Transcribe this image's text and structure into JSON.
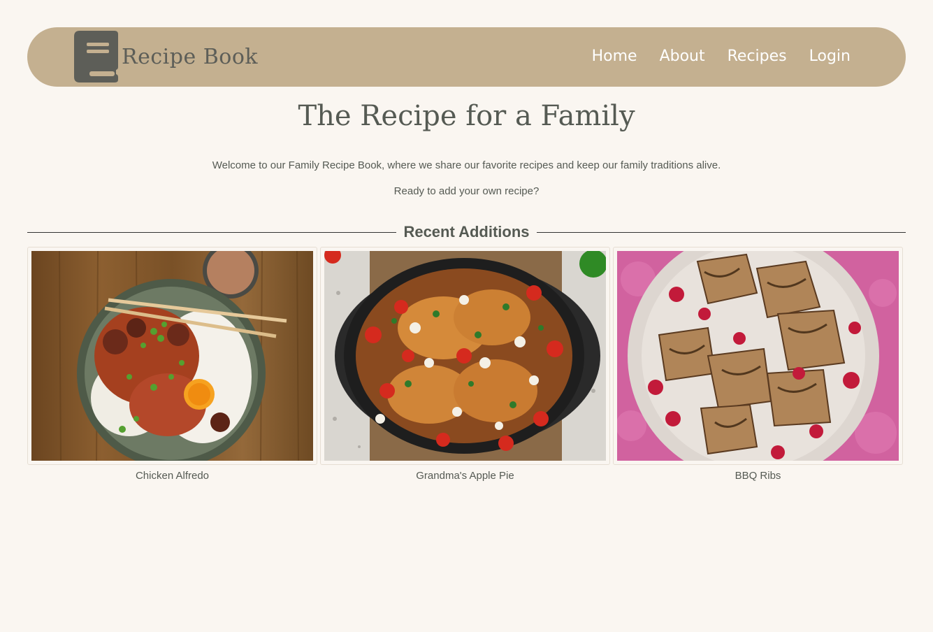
{
  "header": {
    "logo_icon": "book-icon",
    "brand": "Recipe Book",
    "nav": [
      "Home",
      "About",
      "Recipes",
      "Login"
    ]
  },
  "hero": {
    "title": "The Recipe for a Family",
    "intro": "Welcome to our Family Recipe Book, where we share our favorite recipes and keep our family traditions alive.",
    "prompt": "Ready to add your own recipe?"
  },
  "recent": {
    "heading": "Recent Additions",
    "cards": [
      {
        "title": "Chicken Alfredo"
      },
      {
        "title": "Grandma's Apple Pie"
      },
      {
        "title": "BBQ Ribs"
      }
    ]
  },
  "colors": {
    "navbar": "#c4b090",
    "background": "#faf6f1",
    "text": "#555a53",
    "nav_text": "#ffffff"
  }
}
